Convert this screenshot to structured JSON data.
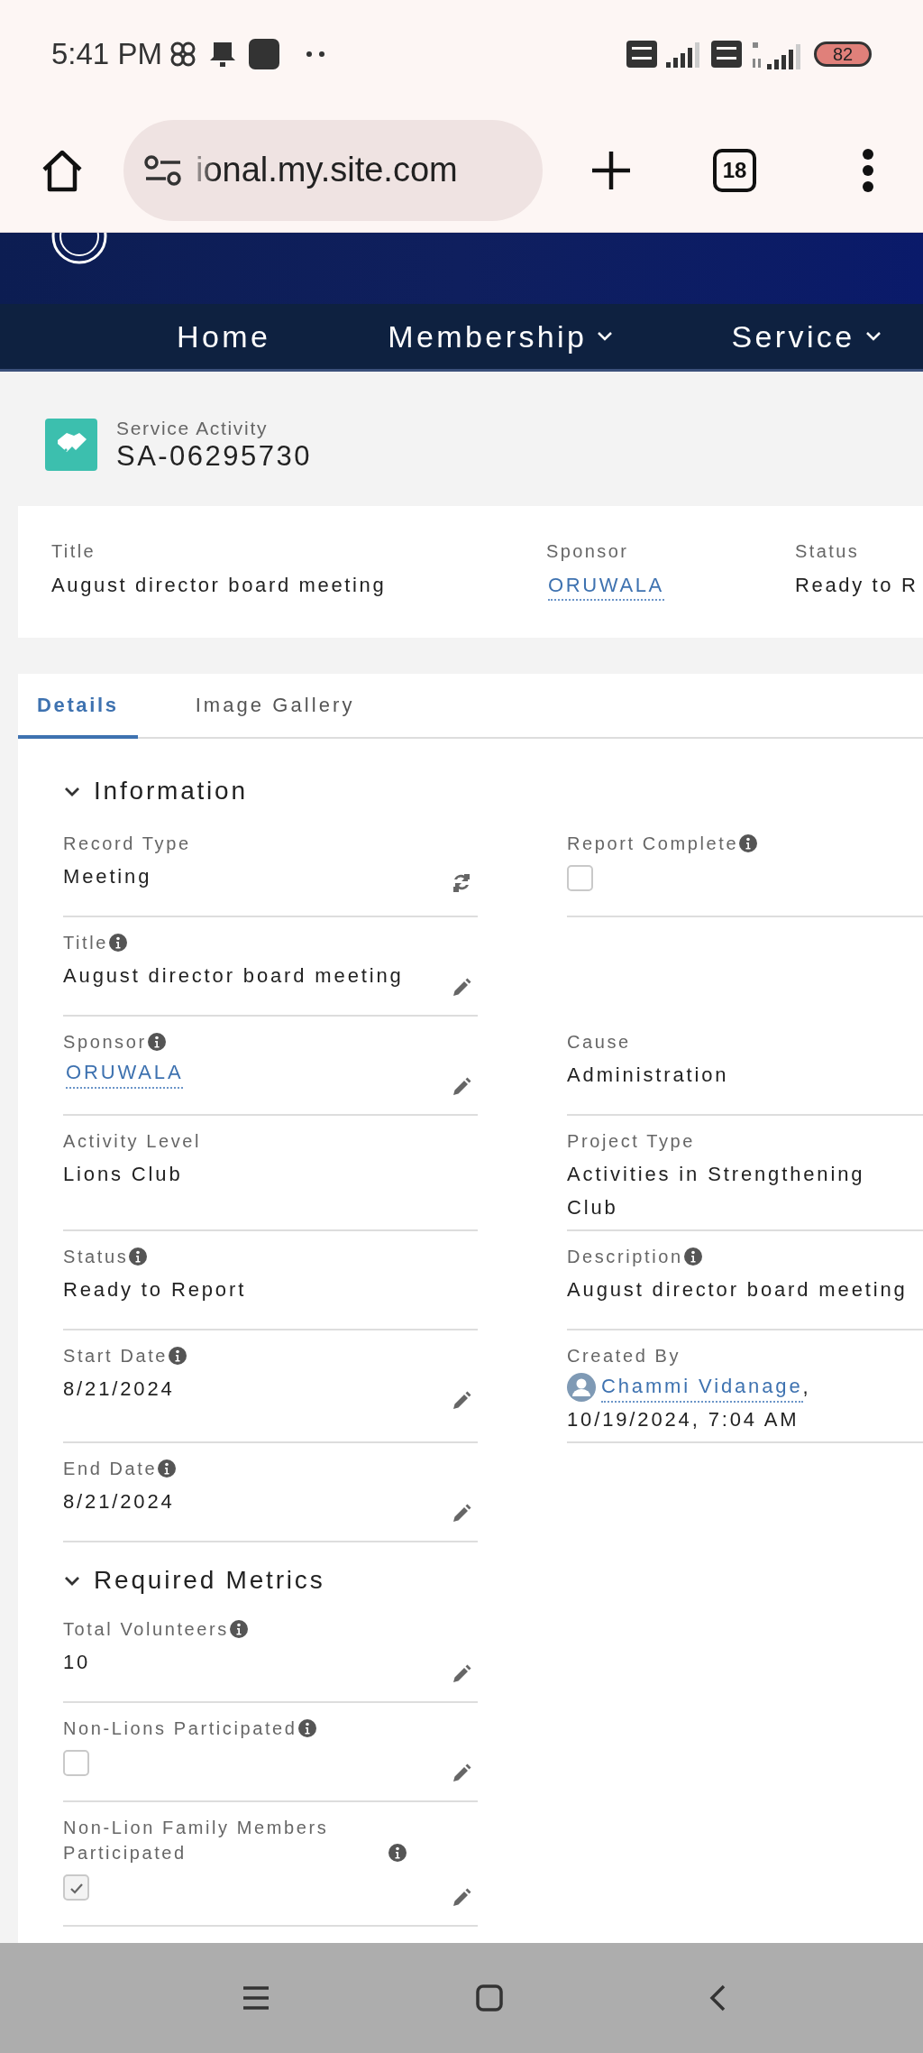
{
  "status_bar": {
    "time": "5:41 PM",
    "battery": "82"
  },
  "browser": {
    "url": "ional.my.site.com",
    "tab_count": "18"
  },
  "nav": [
    {
      "label": "Home",
      "dropdown": false
    },
    {
      "label": "Membership",
      "dropdown": true
    },
    {
      "label": "Service",
      "dropdown": true
    }
  ],
  "record": {
    "object_label": "Service Activity",
    "record_id": "SA-06295730"
  },
  "highlights": [
    {
      "label": "Title",
      "value": "August director board meeting",
      "kind": "text"
    },
    {
      "label": "Sponsor",
      "value": "ORUWALA",
      "kind": "link"
    },
    {
      "label": "Status",
      "value": "Ready to R",
      "kind": "text"
    }
  ],
  "tabs": [
    {
      "label": "Details",
      "selected": true
    },
    {
      "label": "Image Gallery",
      "selected": false
    }
  ],
  "sections": [
    {
      "title": "Information",
      "expanded": true,
      "rows": [
        {
          "left": {
            "label": "Record Type",
            "info": false,
            "kind": "text",
            "value": "Meeting",
            "change": true
          },
          "right": {
            "label": "Report Complete",
            "info": true,
            "kind": "checkbox",
            "checked": false
          }
        },
        {
          "left": {
            "label": "Title",
            "info": true,
            "kind": "text",
            "value": "August director board meeting",
            "edit": true
          }
        },
        {
          "left": {
            "label": "Sponsor",
            "info": true,
            "kind": "link",
            "value": "ORUWALA",
            "edit": true
          },
          "right": {
            "label": "Cause",
            "info": false,
            "kind": "text",
            "value": "Administration"
          }
        },
        {
          "left": {
            "label": "Activity Level",
            "info": false,
            "kind": "text",
            "value": "Lions Club"
          },
          "right": {
            "label": "Project Type",
            "info": false,
            "kind": "text",
            "value": "Activities in Strengthening Club"
          }
        },
        {
          "left": {
            "label": "Status",
            "info": true,
            "kind": "text",
            "value": "Ready to Report"
          },
          "right": {
            "label": "Description",
            "info": true,
            "kind": "text",
            "value": "August director board meeting"
          }
        },
        {
          "left": {
            "label": "Start Date",
            "info": true,
            "kind": "text",
            "value": "8/21/2024",
            "edit": true
          },
          "right": {
            "label": "Created By",
            "info": false,
            "kind": "user",
            "value": "Chammi Vidanage",
            "after": ",",
            "detail": "10/19/2024, 7:04 AM"
          }
        },
        {
          "left": {
            "label": "End Date",
            "info": true,
            "kind": "text",
            "value": "8/21/2024",
            "edit": true
          }
        }
      ]
    },
    {
      "title": "Required Metrics",
      "expanded": true,
      "rows": [
        {
          "left": {
            "label": "Total Volunteers",
            "info": true,
            "kind": "text",
            "value": "10",
            "edit": true
          }
        },
        {
          "left": {
            "label": "Non-Lions Participated",
            "info": true,
            "kind": "checkbox",
            "checked": false,
            "edit": true
          }
        },
        {
          "left": {
            "label": "Non-Lion Family Members Participated",
            "info": true,
            "kind": "checkbox",
            "checked": true,
            "edit": true
          }
        }
      ]
    }
  ]
}
